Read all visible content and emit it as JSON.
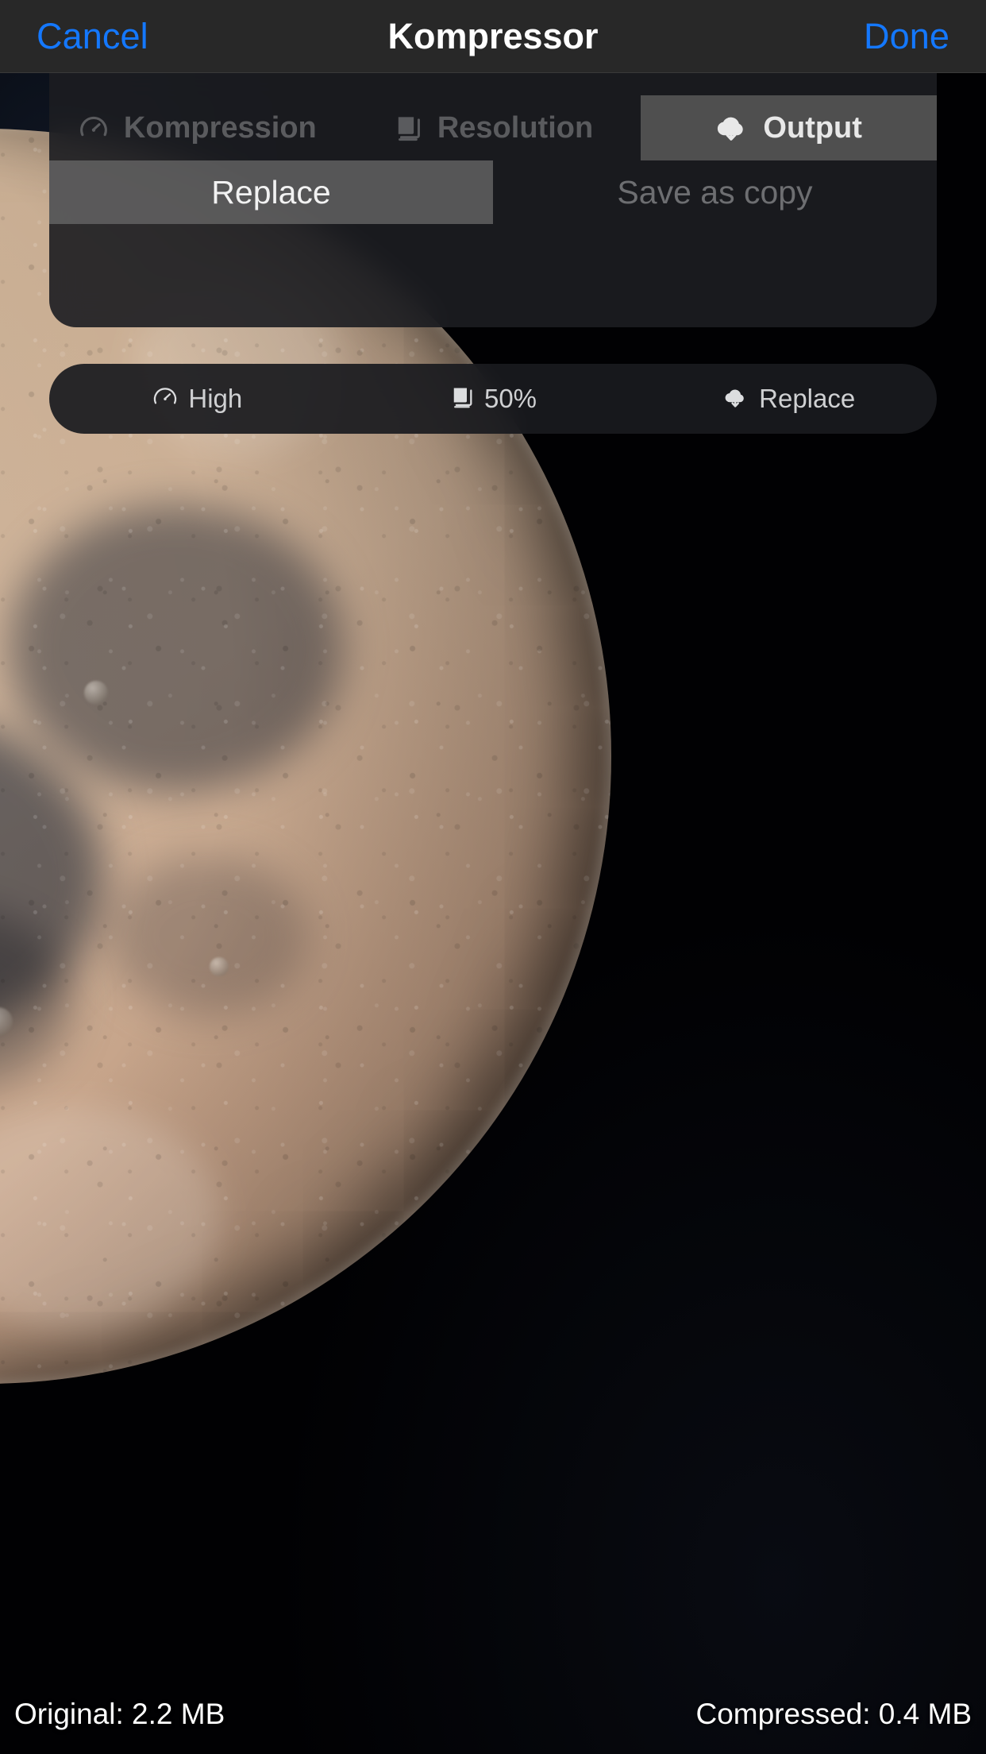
{
  "navbar": {
    "cancel_label": "Cancel",
    "title": "Kompressor",
    "done_label": "Done",
    "accent_color": "#1478ff",
    "background_color": "#282828"
  },
  "tabs": [
    {
      "id": "kompression",
      "label": "Kompression",
      "icon": "gauge-icon",
      "selected": false
    },
    {
      "id": "resolution",
      "label": "Resolution",
      "icon": "layers-icon",
      "selected": false
    },
    {
      "id": "output",
      "label": "Output",
      "icon": "cloud-download-icon",
      "selected": true
    }
  ],
  "output_modes": [
    {
      "id": "replace",
      "label": "Replace",
      "selected": true
    },
    {
      "id": "save-as-copy",
      "label": "Save as copy",
      "selected": false
    }
  ],
  "status_pill": [
    {
      "id": "quality",
      "label": "High",
      "icon": "gauge-icon"
    },
    {
      "id": "resolution",
      "label": "50%",
      "icon": "layers-icon"
    },
    {
      "id": "output",
      "label": "Replace",
      "icon": "cloud-download-icon"
    }
  ],
  "footer": {
    "original_label": "Original: 2.2 MB",
    "compressed_label": "Compressed: 0.4 MB"
  },
  "colors": {
    "selected_tab_bg": "#4f4f4f",
    "panel_bg": "rgba(28,29,33,0.90)",
    "pill_bg": "rgba(25,26,30,0.92)",
    "inactive_text": "#5a5b5e",
    "active_text": "#e8e8e8"
  }
}
